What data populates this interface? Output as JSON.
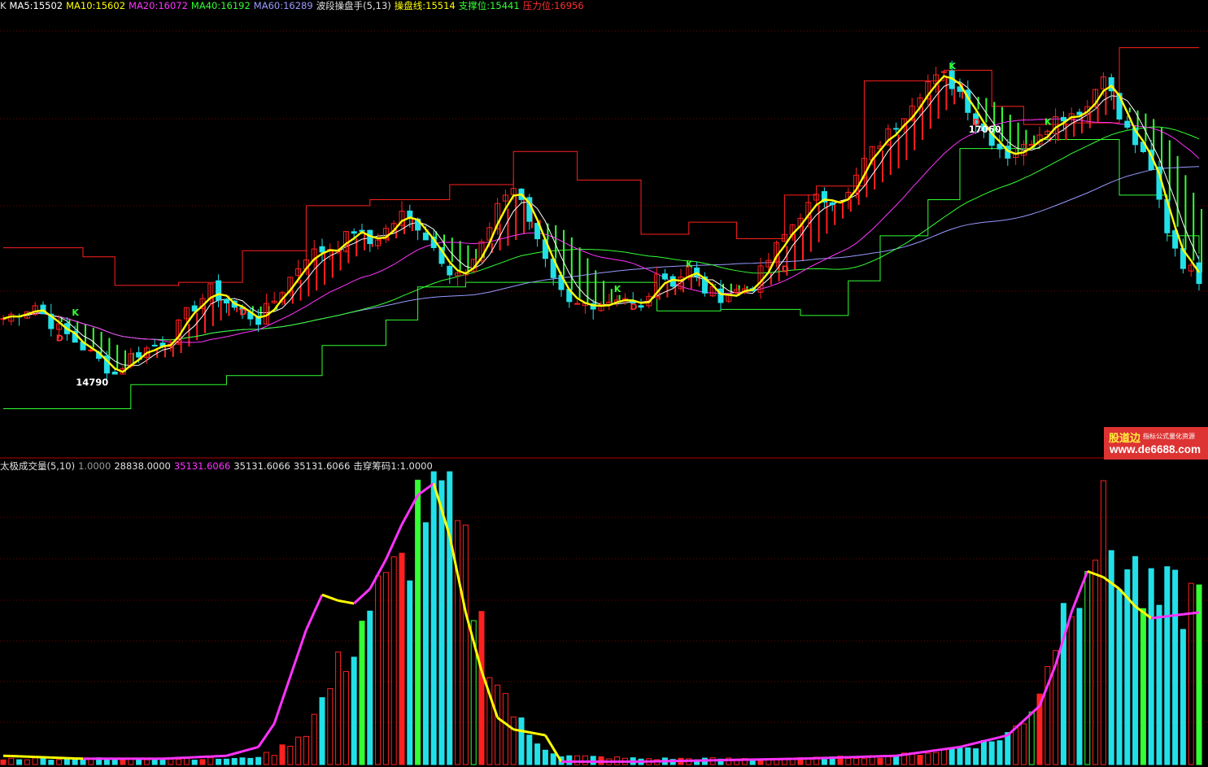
{
  "header_top": {
    "items": [
      {
        "text": "K",
        "color": "#e0e0e0"
      },
      {
        "text": "MA5:15502",
        "color": "#ffffff"
      },
      {
        "text": "MA10:15602",
        "color": "#ffff00"
      },
      {
        "text": "MA20:16072",
        "color": "#ff33ff"
      },
      {
        "text": "MA40:16192",
        "color": "#33ff33"
      },
      {
        "text": "MA60:16289",
        "color": "#9a9aff"
      },
      {
        "text": "波段操盘手(5,13)",
        "color": "#e0e0e0"
      },
      {
        "text": "操盘线:15514",
        "color": "#ffff00"
      },
      {
        "text": "支撑位:15441",
        "color": "#33ff33"
      },
      {
        "text": "压力位:16956",
        "color": "#ff3030"
      }
    ]
  },
  "header_bottom": {
    "items": [
      {
        "text": "太极成交量(5,10)",
        "color": "#e0e0e0"
      },
      {
        "text": "1.0000",
        "color": "#9a9a9a"
      },
      {
        "text": "28838.0000",
        "color": "#e0e0e0"
      },
      {
        "text": "35131.6066",
        "color": "#ff33ff"
      },
      {
        "text": "35131.6066",
        "color": "#e0e0e0"
      },
      {
        "text": "35131.6066",
        "color": "#e0e0e0"
      },
      {
        "text": "击穿筹码1:1.0000",
        "color": "#e0e0e0"
      }
    ]
  },
  "watermark": {
    "line1": "股道边",
    "line1_small": "指标公式量化资源",
    "line2": "www.de6688.com"
  },
  "colors": {
    "up": "#ff2020",
    "down": "#22e0e8",
    "ma5": "#ffffff",
    "ma10": "#ffff00",
    "ma20": "#ff33ff",
    "ma40": "#33ff33",
    "ma60": "#9a9aff",
    "grid": "#7a0000",
    "resist": "#ff2020",
    "support": "#33ff33"
  },
  "chart_data": [
    {
      "type": "candlestick",
      "title": "",
      "ylim": [
        14400,
        17250
      ],
      "annotations": [
        {
          "text": "17060",
          "kind": "high",
          "index": 126
        },
        {
          "text": "14790",
          "kind": "low",
          "index": 14
        },
        {
          "text": "K",
          "kind": "sell-signal",
          "index": 8
        },
        {
          "text": "D",
          "kind": "buy-signal",
          "index": 6
        },
        {
          "text": "D",
          "kind": "buy-signal",
          "index": 29
        },
        {
          "text": "K",
          "kind": "sell-signal",
          "index": 76
        },
        {
          "text": "D",
          "kind": "buy-signal",
          "index": 78
        },
        {
          "text": "K",
          "kind": "sell-signal",
          "index": 85
        },
        {
          "text": "K",
          "kind": "sell-signal",
          "index": 118
        },
        {
          "text": "D",
          "kind": "buy-signal",
          "index": 97
        },
        {
          "text": "D",
          "kind": "buy-signal",
          "index": 121
        },
        {
          "text": "K",
          "kind": "sell-signal",
          "index": 130
        }
      ],
      "close_anchors": [
        [
          0,
          15230
        ],
        [
          4,
          15320
        ],
        [
          6,
          15200
        ],
        [
          10,
          15040
        ],
        [
          14,
          14860
        ],
        [
          16,
          14980
        ],
        [
          21,
          15100
        ],
        [
          23,
          15260
        ],
        [
          26,
          15420
        ],
        [
          29,
          15300
        ],
        [
          32,
          15220
        ],
        [
          34,
          15350
        ],
        [
          38,
          15650
        ],
        [
          42,
          15720
        ],
        [
          44,
          15820
        ],
        [
          46,
          15730
        ],
        [
          48,
          15820
        ],
        [
          50,
          15920
        ],
        [
          52,
          15850
        ],
        [
          56,
          15560
        ],
        [
          58,
          15520
        ],
        [
          60,
          15700
        ],
        [
          62,
          16000
        ],
        [
          64,
          16100
        ],
        [
          66,
          15880
        ],
        [
          68,
          15650
        ],
        [
          70,
          15400
        ],
        [
          72,
          15350
        ],
        [
          74,
          15260
        ],
        [
          76,
          15300
        ],
        [
          78,
          15340
        ],
        [
          80,
          15300
        ],
        [
          82,
          15540
        ],
        [
          84,
          15470
        ],
        [
          86,
          15560
        ],
        [
          88,
          15420
        ],
        [
          90,
          15380
        ],
        [
          94,
          15450
        ],
        [
          96,
          15620
        ],
        [
          98,
          15780
        ],
        [
          100,
          15930
        ],
        [
          102,
          16020
        ],
        [
          104,
          16030
        ],
        [
          106,
          16050
        ],
        [
          108,
          16280
        ],
        [
          110,
          16400
        ],
        [
          112,
          16520
        ],
        [
          114,
          16680
        ],
        [
          116,
          16800
        ],
        [
          118,
          16840
        ],
        [
          120,
          16740
        ],
        [
          122,
          16540
        ],
        [
          124,
          16420
        ],
        [
          126,
          16320
        ],
        [
          128,
          16360
        ],
        [
          130,
          16480
        ],
        [
          132,
          16560
        ],
        [
          134,
          16600
        ],
        [
          136,
          16640
        ],
        [
          138,
          16880
        ],
        [
          140,
          16560
        ],
        [
          142,
          16400
        ],
        [
          144,
          16200
        ],
        [
          146,
          15820
        ],
        [
          148,
          15600
        ],
        [
          150,
          15500
        ]
      ],
      "support_steps": [
        [
          0,
          14630
        ],
        [
          16,
          14790
        ],
        [
          28,
          14850
        ],
        [
          40,
          15050
        ],
        [
          48,
          15220
        ],
        [
          52,
          15440
        ],
        [
          58,
          15470
        ],
        [
          82,
          15280
        ],
        [
          90,
          15290
        ],
        [
          100,
          15250
        ],
        [
          106,
          15480
        ],
        [
          110,
          15780
        ],
        [
          116,
          16020
        ],
        [
          120,
          16360
        ],
        [
          130,
          16420
        ],
        [
          140,
          16050
        ],
        [
          146,
          15780
        ],
        [
          150,
          15660
        ]
      ],
      "resist_steps": [
        [
          0,
          15700
        ],
        [
          10,
          15640
        ],
        [
          14,
          15450
        ],
        [
          22,
          15470
        ],
        [
          30,
          15680
        ],
        [
          38,
          15980
        ],
        [
          46,
          16020
        ],
        [
          56,
          16120
        ],
        [
          64,
          16340
        ],
        [
          70,
          16340
        ],
        [
          72,
          16150
        ],
        [
          80,
          15790
        ],
        [
          86,
          15870
        ],
        [
          92,
          15760
        ],
        [
          98,
          16050
        ],
        [
          102,
          16110
        ],
        [
          108,
          16810
        ],
        [
          118,
          16880
        ],
        [
          124,
          16640
        ],
        [
          128,
          16520
        ],
        [
          134,
          16530
        ],
        [
          140,
          17030
        ],
        [
          150,
          17030
        ]
      ],
      "ma_periods": {
        "MA5": 5,
        "MA10": 10,
        "MA20": 20,
        "MA40": 40,
        "MA60": 60
      }
    },
    {
      "type": "bar+line",
      "title": "",
      "values_scale": "relative",
      "volume_anchors": [
        [
          0,
          2
        ],
        [
          20,
          2
        ],
        [
          30,
          2
        ],
        [
          34,
          4
        ],
        [
          38,
          12
        ],
        [
          40,
          22
        ],
        [
          42,
          33
        ],
        [
          44,
          44
        ],
        [
          46,
          56
        ],
        [
          48,
          60
        ],
        [
          50,
          68
        ],
        [
          52,
          90
        ],
        [
          54,
          99
        ],
        [
          56,
          88
        ],
        [
          58,
          70
        ],
        [
          60,
          48
        ],
        [
          62,
          30
        ],
        [
          64,
          18
        ],
        [
          66,
          10
        ],
        [
          68,
          6
        ],
        [
          70,
          3
        ],
        [
          80,
          2
        ],
        [
          100,
          2
        ],
        [
          112,
          3
        ],
        [
          118,
          5
        ],
        [
          124,
          8
        ],
        [
          128,
          14
        ],
        [
          130,
          28
        ],
        [
          132,
          45
        ],
        [
          134,
          62
        ],
        [
          136,
          78
        ],
        [
          138,
          82
        ],
        [
          140,
          72
        ],
        [
          142,
          66
        ],
        [
          144,
          56
        ]
      ],
      "line_anchors": [
        [
          0,
          3
        ],
        [
          10,
          2
        ],
        [
          20,
          2
        ],
        [
          28,
          3
        ],
        [
          32,
          6
        ],
        [
          34,
          14
        ],
        [
          36,
          30
        ],
        [
          38,
          46
        ],
        [
          40,
          58
        ],
        [
          42,
          56
        ],
        [
          44,
          55
        ],
        [
          46,
          60
        ],
        [
          48,
          70
        ],
        [
          50,
          82
        ],
        [
          52,
          92
        ],
        [
          54,
          96
        ],
        [
          56,
          78
        ],
        [
          58,
          52
        ],
        [
          60,
          32
        ],
        [
          62,
          16
        ],
        [
          64,
          12
        ],
        [
          66,
          11
        ],
        [
          68,
          10
        ],
        [
          70,
          1
        ],
        [
          80,
          1
        ],
        [
          100,
          2
        ],
        [
          112,
          3
        ],
        [
          120,
          6
        ],
        [
          126,
          10
        ],
        [
          130,
          20
        ],
        [
          132,
          34
        ],
        [
          134,
          52
        ],
        [
          136,
          66
        ],
        [
          138,
          64
        ],
        [
          140,
          60
        ],
        [
          142,
          54
        ],
        [
          144,
          50
        ]
      ]
    }
  ]
}
